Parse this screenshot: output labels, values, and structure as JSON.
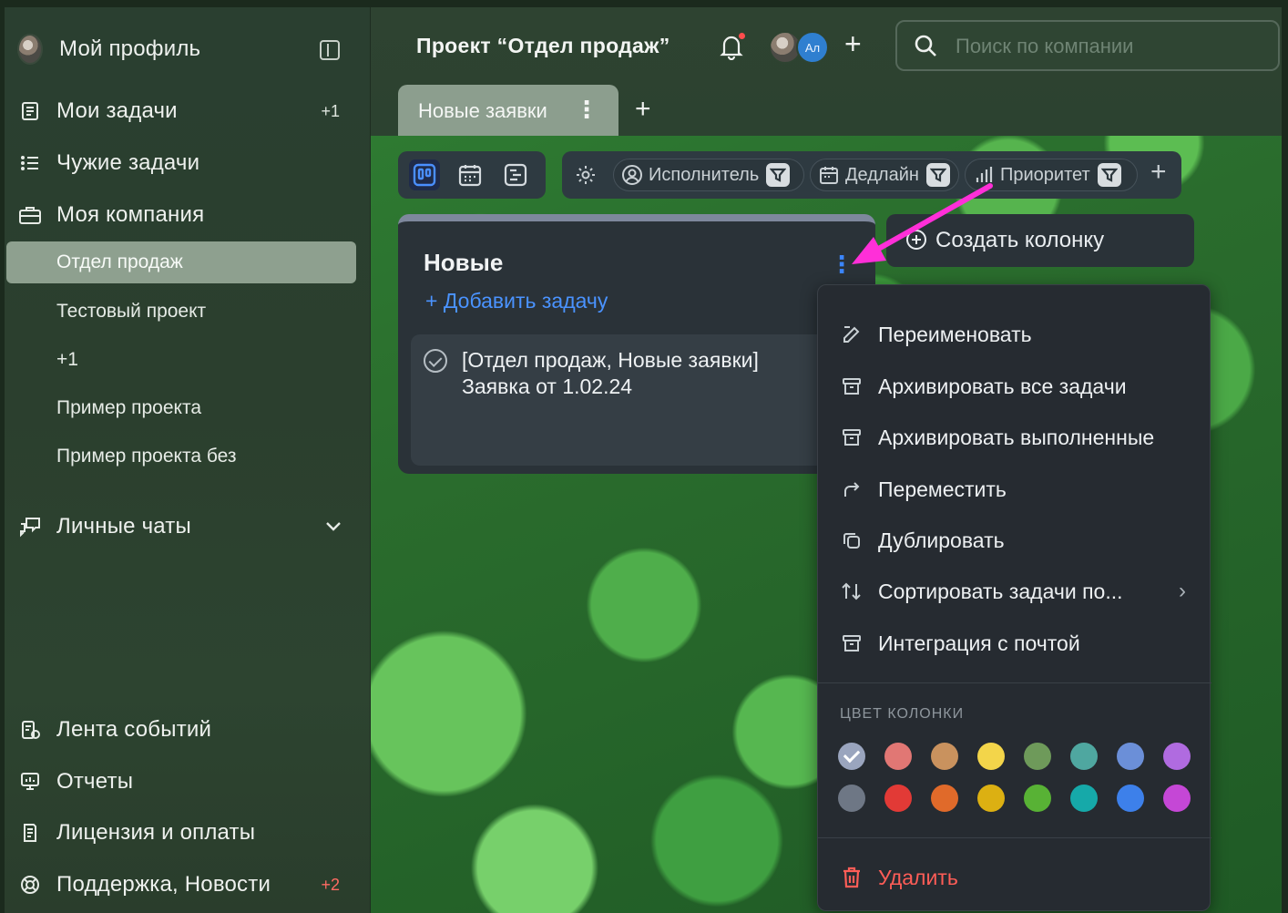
{
  "sidebar": {
    "profile_label": "Мой профиль",
    "my_tasks_label": "Мои задачи",
    "my_tasks_count": "+1",
    "other_tasks_label": "Чужие задачи",
    "my_company_label": "Моя компания",
    "projects": [
      {
        "label": "Отдел продаж",
        "active": true
      },
      {
        "label": "Тестовый проект"
      },
      {
        "label": "+1"
      },
      {
        "label": "Пример проекта"
      },
      {
        "label": "Пример проекта без"
      }
    ],
    "personal_chats_label": "Личные чаты",
    "events_label": "Лента событий",
    "reports_label": "Отчеты",
    "license_label": "Лицензия и оплаты",
    "support_label": "Поддержка, Новости",
    "support_count": "+2"
  },
  "header": {
    "project_title": "Проект “Отдел продаж”",
    "member_initials": "Ал",
    "search_placeholder": "Поиск по компании"
  },
  "tabs": {
    "active_label": "Новые заявки",
    "more_glyph": "⋮",
    "add_glyph": "+"
  },
  "toolbar": {
    "filters": [
      {
        "label": "Исполнитель",
        "icon": "user-circle-icon"
      },
      {
        "label": "Дедлайн",
        "icon": "calendar-icon"
      },
      {
        "label": "Приоритет",
        "icon": "bar-chart-icon"
      }
    ]
  },
  "column": {
    "title": "Новые",
    "add_task_label": "+ Добавить задачу",
    "task_line1": "[Отдел продаж, Новые заявки]",
    "task_line2": "Заявка от 1.02.24"
  },
  "create_column_label": "Создать колонку",
  "menu": {
    "items": [
      {
        "label": "Переименовать",
        "icon": "pencil-icon"
      },
      {
        "label": "Архивировать все задачи",
        "icon": "archive-icon"
      },
      {
        "label": "Архивировать выполненные",
        "icon": "archive-icon"
      },
      {
        "label": "Переместить",
        "icon": "move-arrow-icon"
      },
      {
        "label": "Дублировать",
        "icon": "copy-icon"
      },
      {
        "label": "Сортировать задачи по...",
        "icon": "sort-icon"
      },
      {
        "label": "Интеграция с почтой",
        "icon": "archive-icon"
      }
    ],
    "color_section_title": "ЦВЕТ КОЛОНКИ",
    "colors_row1": [
      "#9aa5be",
      "#e17774",
      "#c9925e",
      "#f3d54a",
      "#6e9a5a",
      "#4fa7a0",
      "#6b8fd8",
      "#b06be0"
    ],
    "colors_row2": [
      "#6e7785",
      "#e23a36",
      "#e06a2a",
      "#dcb012",
      "#58b235",
      "#16a9a9",
      "#3d80ea",
      "#c547d6"
    ],
    "selected_color": "#9aa5be",
    "delete_label": "Удалить"
  },
  "colors": {
    "accent_blue": "#3b86ff",
    "arrow_magenta": "#ff2fd8",
    "danger_red": "#ff5d57"
  }
}
